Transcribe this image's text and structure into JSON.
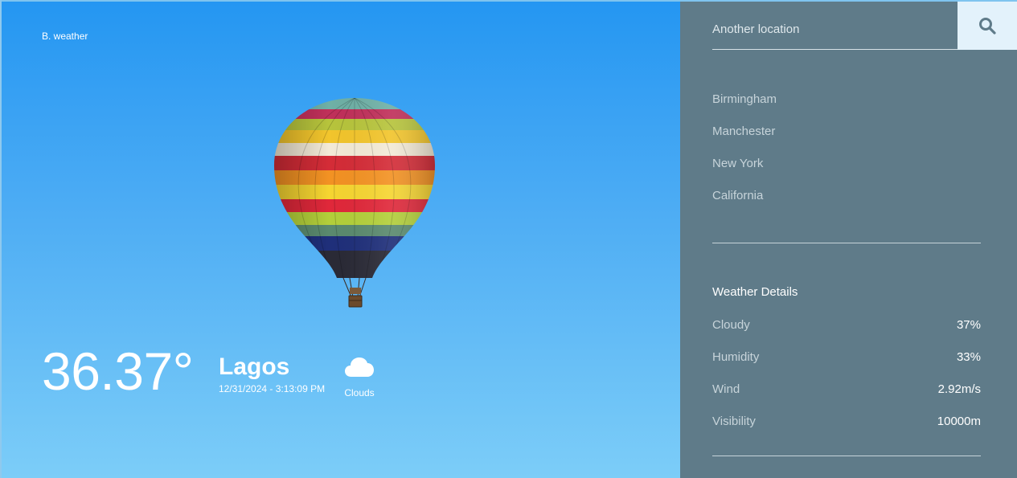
{
  "brand": "B. weather",
  "current": {
    "temperature": "36.37°",
    "city": "Lagos",
    "datetime": "12/31/2024 - 3:13:09 PM",
    "condition": "Clouds",
    "condition_icon": "cloud-icon"
  },
  "search": {
    "placeholder": "Another location",
    "icon": "search-icon"
  },
  "cities": [
    {
      "label": "Birmingham"
    },
    {
      "label": "Manchester"
    },
    {
      "label": "New York"
    },
    {
      "label": "California"
    }
  ],
  "details": {
    "title": "Weather Details",
    "rows": [
      {
        "label": "Cloudy",
        "value": "37%"
      },
      {
        "label": "Humidity",
        "value": "33%"
      },
      {
        "label": "Wind",
        "value": "2.92m/s"
      },
      {
        "label": "Visibility",
        "value": "10000m"
      }
    ]
  },
  "colors": {
    "sky_top": "#2496f2",
    "sky_bottom": "#7ccdf8",
    "sidebar_bg": "#5f7b89",
    "search_button_bg": "#e3f2fb",
    "search_icon": "#5f7b89"
  }
}
